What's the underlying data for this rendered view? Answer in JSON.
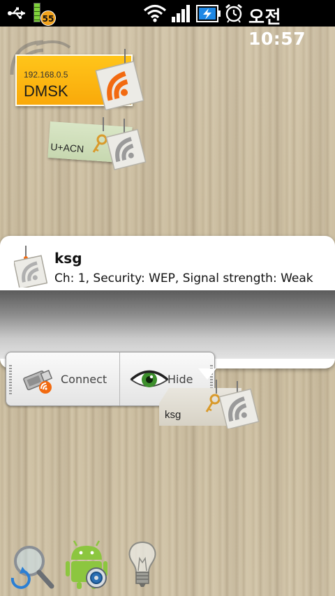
{
  "status_bar": {
    "battery_badge": "55",
    "time": "오전 10:57"
  },
  "networks": [
    {
      "ssid": "DMSK",
      "ip": "192.168.0.5"
    },
    {
      "ssid": "U+ACN"
    },
    {
      "ssid": "ksg"
    }
  ],
  "popup": {
    "ssid": "ksg",
    "details": "Ch: 1, Security: WEP, Signal strength: Weak",
    "connect_label": "Connect",
    "hide_label": "Hide"
  },
  "icons": {
    "usb": "usb-icon",
    "battery": "battery-icon",
    "wifi": "wifi-icon",
    "signal": "signal-icon",
    "charging": "charging-icon",
    "alarm": "alarm-icon",
    "refresh_search": "search-refresh-icon",
    "android_settings": "android-settings-icon",
    "lightbulb": "lightbulb-icon"
  },
  "colors": {
    "accent_orange": "#f26a10",
    "note_yellow": "#f9b40e",
    "note_green": "#cfdfb9"
  }
}
